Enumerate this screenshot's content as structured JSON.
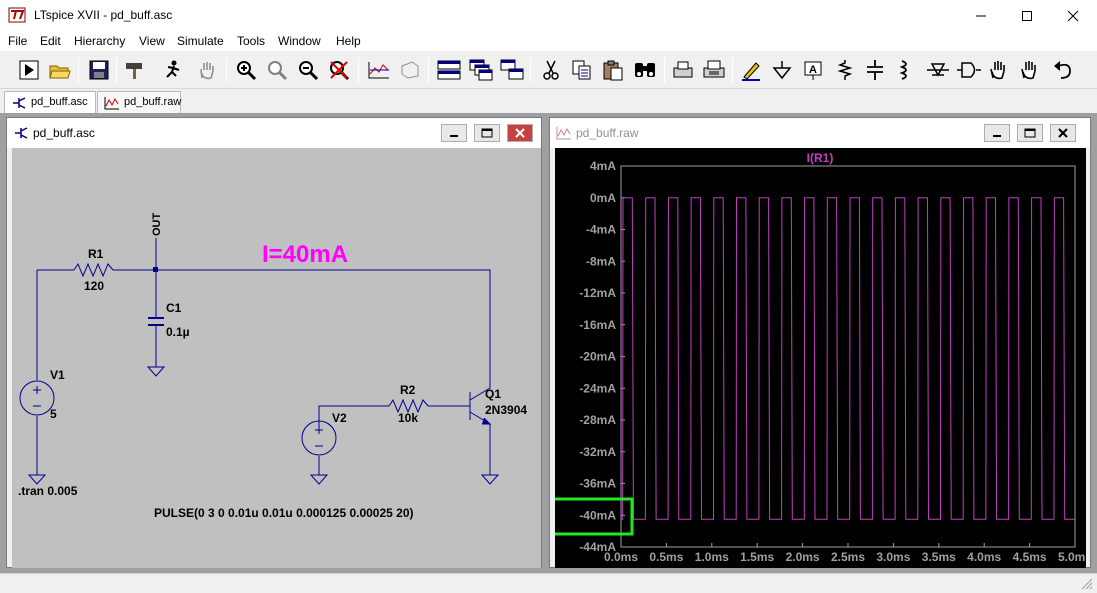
{
  "app": {
    "title": "LTspice XVII - pd_buff.asc",
    "icon": "ltspice-logo-icon"
  },
  "menu": [
    "File",
    "Edit",
    "Hierarchy",
    "View",
    "Simulate",
    "Tools",
    "Window",
    "Help"
  ],
  "toolbar": {
    "icons": [
      "run-icon",
      "open-folder-icon",
      "save-icon",
      "control-panel-hammer-icon",
      "halt-run-icon",
      "pan-hand-icon",
      "zoom-in-icon",
      "zoom-area-icon",
      "zoom-out-icon",
      "zoom-cancel-icon",
      "autorange-icon",
      "3d-view-icon",
      "tile-horizontal-icon",
      "cascade-icon",
      "tile-icon",
      "cut-icon",
      "copy-icon",
      "paste-icon",
      "find-binoculars-icon",
      "print-preview-icon",
      "print-icon",
      "draw-wire-icon",
      "ground-icon",
      "label-icon",
      "resistor-icon",
      "capacitor-icon",
      "inductor-icon",
      "diode-icon",
      "component-icon",
      "move-hand-icon",
      "drag-hand-icon",
      "undo-icon"
    ]
  },
  "tabs": [
    {
      "label": "pd_buff.asc",
      "active": true
    },
    {
      "label": "pd_buff.raw",
      "active": false
    }
  ],
  "schematic": {
    "title": "pd_buff.asc",
    "annotation": "I=40mA",
    "annotation_color": "#ff00ff",
    "net_out": "OUT",
    "components": {
      "R1": {
        "name": "R1",
        "value": "120"
      },
      "C1": {
        "name": "C1",
        "value": "0.1µ"
      },
      "V1": {
        "name": "V1",
        "value": "5"
      },
      "R2": {
        "name": "R2",
        "value": "10k"
      },
      "Q1": {
        "name": "Q1",
        "value": "2N3904"
      },
      "V2": {
        "name": "V2"
      }
    },
    "directive": ".tran 0.005",
    "pulse": "PULSE(0 3 0 0.01u 0.01u 0.000125 0.00025 20)",
    "wire_color": "#00008b"
  },
  "waveform": {
    "title": "pd_buff.raw",
    "trace_label": "I(R1)",
    "trace_color": "#c040c0",
    "highlight_color": "#22e822",
    "highlight_tick": "-40mA"
  },
  "chart_data": {
    "type": "line",
    "title": "I(R1)",
    "xlabel": "",
    "ylabel": "",
    "xlim": [
      0,
      5
    ],
    "ylim": [
      -44,
      4
    ],
    "x_ticks": [
      "0.0ms",
      "0.5ms",
      "1.0ms",
      "1.5ms",
      "2.0ms",
      "2.5ms",
      "3.0ms",
      "3.5ms",
      "4.0ms",
      "4.5ms",
      "5.0ms"
    ],
    "y_ticks": [
      "4mA",
      "0mA",
      "-4mA",
      "-8mA",
      "-12mA",
      "-16mA",
      "-20mA",
      "-24mA",
      "-28mA",
      "-32mA",
      "-36mA",
      "-40mA",
      "-44mA"
    ],
    "series": [
      {
        "name": "I(R1)",
        "waveform": "square",
        "low": -40.5,
        "high": 0,
        "period_ms": 0.25,
        "high_time_ms": 0.125,
        "start_ms": 0,
        "end_ms": 5.0
      }
    ],
    "grid": false
  }
}
